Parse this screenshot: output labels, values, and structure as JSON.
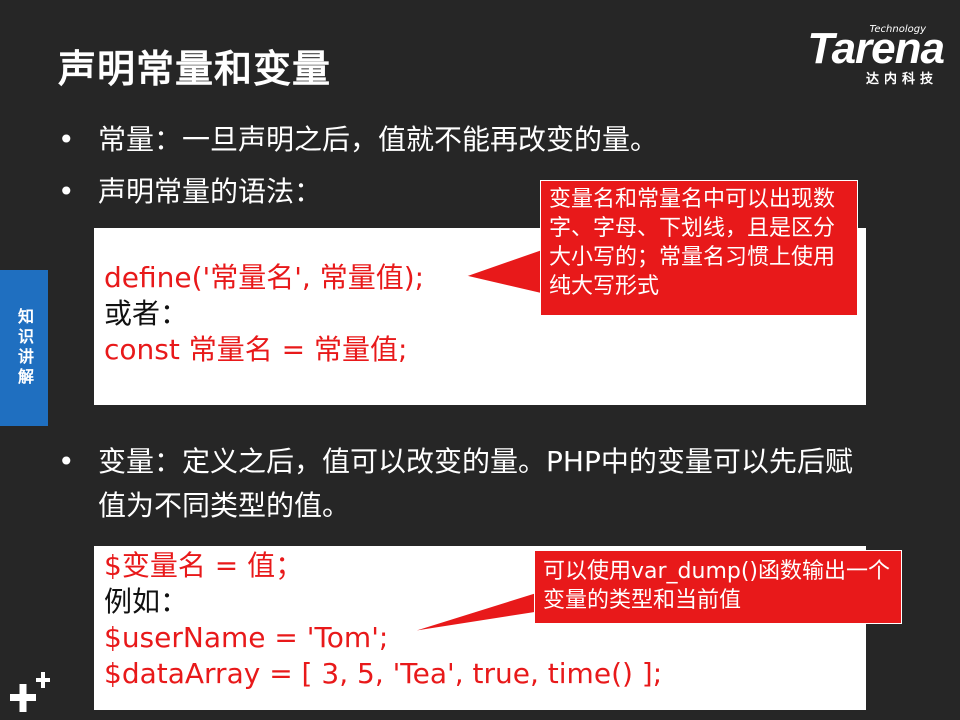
{
  "slide": {
    "title": "声明常量和变量",
    "side_tab": "知识讲解"
  },
  "logo": {
    "tech": "Technology",
    "word": "Tarena",
    "cn": "达内科技"
  },
  "bullets": [
    {
      "marker": "•",
      "text": "常量：一旦声明之后，值就不能再改变的量。"
    },
    {
      "marker": "•",
      "text": "声明常量的语法："
    },
    {
      "marker": "•",
      "text": "变量：定义之后，值可以改变的量。PHP中的变量可以先后赋值为不同类型的值。"
    }
  ],
  "code_box_1": {
    "lines": [
      "define('常量名', 常量值);",
      "或者：",
      "const 常量名 = 常量值;"
    ]
  },
  "code_box_2": {
    "lines": [
      "$变量名 = 值；",
      "例如：",
      "$userName = 'Tom';",
      "$dataArray = [ 3, 5, 'Tea', true, time() ];"
    ]
  },
  "callouts": [
    {
      "text": "变量名和常量名中可以出现数字、字母、下划线，且是区分大小写的；常量名习惯上使用纯大写形式"
    },
    {
      "text": "可以使用var_dump()函数输出一个变量的类型和当前值"
    }
  ],
  "colors": {
    "background": "#262626",
    "code_red": "#e8191a",
    "callout_red": "#e8191a",
    "side_tab_blue": "#1f6fc0"
  }
}
